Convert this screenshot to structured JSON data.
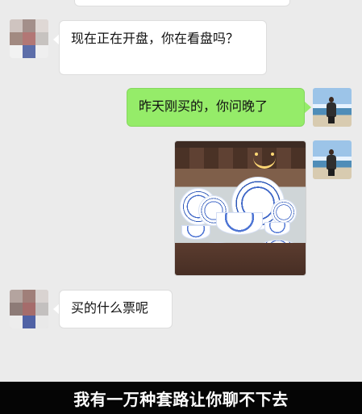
{
  "messages": {
    "m1": "现在正在开盘，你在看盘吗？",
    "m2": "昨天刚买的，你问晚了",
    "m3": "买的什么票呢"
  },
  "caption": "我有一万种套路让你聊不下去"
}
